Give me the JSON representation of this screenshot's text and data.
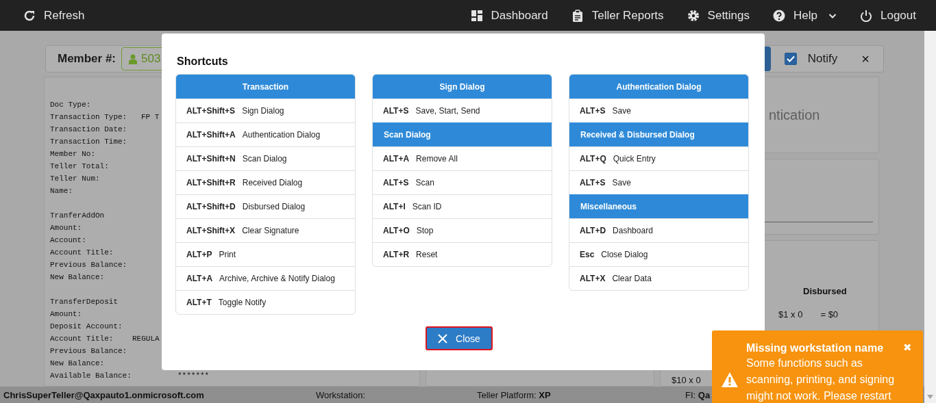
{
  "nav": {
    "refresh": "Refresh",
    "items": [
      {
        "label": "Dashboard",
        "kind": "link"
      },
      {
        "label": "Teller Reports",
        "kind": "link"
      },
      {
        "label": "Settings",
        "kind": "link"
      },
      {
        "label": "Help",
        "kind": "dropdown"
      },
      {
        "label": "Logout",
        "kind": "link"
      }
    ]
  },
  "member_bar": {
    "label": "Member #:",
    "value": "503",
    "notify": {
      "label": "Notify",
      "checked": true
    },
    "close": "×"
  },
  "receipt": {
    "groups": [
      [
        {
          "label": "Doc Type:"
        },
        {
          "label": "Transaction Type:",
          "value": "FP T"
        },
        {
          "label": "Transaction Date:"
        },
        {
          "label": "Transaction Time:"
        },
        {
          "label": "Member No:"
        },
        {
          "label": "Teller Total:"
        },
        {
          "label": "Teller Num:"
        },
        {
          "label": "Name:"
        }
      ],
      [
        {
          "label": "TranferAddOn"
        },
        {
          "label": "Amount:"
        },
        {
          "label": "Account:"
        },
        {
          "label": "Account Title:"
        },
        {
          "label": "Previous Balance:"
        },
        {
          "label": "New Balance:"
        }
      ],
      [
        {
          "label": "TransferDeposit"
        },
        {
          "label": "Amount:"
        },
        {
          "label": "Deposit Account:"
        },
        {
          "label": "Account Title:",
          "value": "REGULA"
        },
        {
          "label": "Previous Balance:"
        },
        {
          "label": "New Balance:"
        },
        {
          "label": "Available Balance:",
          "value": "*******"
        }
      ]
    ]
  },
  "auth_panel": {
    "title": "ntication"
  },
  "cash_panel": {
    "heading": "Disbursed",
    "amount": "$1 x 0",
    "total": "= $0",
    "left_amount": "$10 x 0"
  },
  "status_bar": {
    "user": "ChrisSuperTeller@Qaxpauto1.onmicrosoft.com",
    "workstation": "Workstation:",
    "platform": "Teller Platform: **XP**",
    "fi": "FI: **Qa**"
  },
  "dialog": {
    "title": "Shortcuts",
    "columns": [
      [
        {
          "heading": "Transaction",
          "rows": [
            {
              "keys": "ALT+Shift+S",
              "action": "Sign Dialog"
            },
            {
              "keys": "ALT+Shift+A",
              "action": "Authentication Dialog"
            },
            {
              "keys": "ALT+Shift+N",
              "action": "Scan Dialog"
            },
            {
              "keys": "ALT+Shift+R",
              "action": "Received Dialog"
            },
            {
              "keys": "ALT+Shift+D",
              "action": "Disbursed Dialog"
            },
            {
              "keys": "ALT+Shift+X",
              "action": "Clear Signature"
            },
            {
              "keys": "ALT+P",
              "action": "Print"
            },
            {
              "keys": "ALT+A",
              "action": "Archive, Archive & Notify Dialog"
            },
            {
              "keys": "ALT+T",
              "action": "Toggle Notify"
            }
          ]
        }
      ],
      [
        {
          "heading": "Sign Dialog",
          "rows": [
            {
              "keys": "ALT+S",
              "action": "Save, Start, Send"
            }
          ]
        },
        {
          "heading": "Scan Dialog",
          "rows": [
            {
              "keys": "ALT+A",
              "action": "Remove All"
            },
            {
              "keys": "ALT+S",
              "action": "Scan"
            },
            {
              "keys": "ALT+I",
              "action": "Scan ID"
            },
            {
              "keys": "ALT+O",
              "action": "Stop"
            },
            {
              "keys": "ALT+R",
              "action": "Reset"
            }
          ]
        }
      ],
      [
        {
          "heading": "Authentication Dialog",
          "rows": [
            {
              "keys": "ALT+S",
              "action": "Save"
            }
          ]
        },
        {
          "heading": "Received & Disbursed Dialog",
          "rows": [
            {
              "keys": "ALT+Q",
              "action": "Quick Entry"
            },
            {
              "keys": "ALT+S",
              "action": "Save"
            }
          ]
        },
        {
          "heading": "Miscellaneous",
          "rows": [
            {
              "keys": "ALT+D",
              "action": "Dashboard"
            },
            {
              "keys": "Esc",
              "action": "Close Dialog"
            },
            {
              "keys": "ALT+X",
              "action": "Clear Data"
            }
          ]
        }
      ]
    ],
    "close_button": "Close"
  },
  "toast": {
    "title": "Missing workstation name",
    "message": "Some functions such as scanning, printing, and signing might not work. Please restart",
    "close": "✖"
  }
}
